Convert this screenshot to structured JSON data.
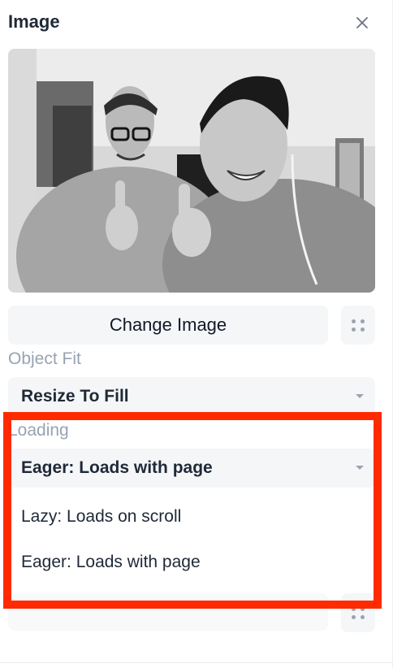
{
  "panel": {
    "title": "Image"
  },
  "photo": {
    "description": "two smiling men giving thumbs up in a black and white selfie"
  },
  "image_actions": {
    "change_label": "Change Image"
  },
  "object_fit": {
    "label": "Object Fit",
    "selected": "Resize To Fill"
  },
  "loading": {
    "label": "Loading",
    "selected": "Eager: Loads with page",
    "options": [
      "Lazy: Loads on scroll",
      "Eager: Loads with page"
    ]
  },
  "icons": {
    "close": "close-icon",
    "drag": "drag-handle-icon",
    "chevron": "chevron-down-icon"
  },
  "colors": {
    "highlight": "#ff2a00",
    "field_background": "#f5f6f8",
    "muted_label": "#98a2b3"
  }
}
